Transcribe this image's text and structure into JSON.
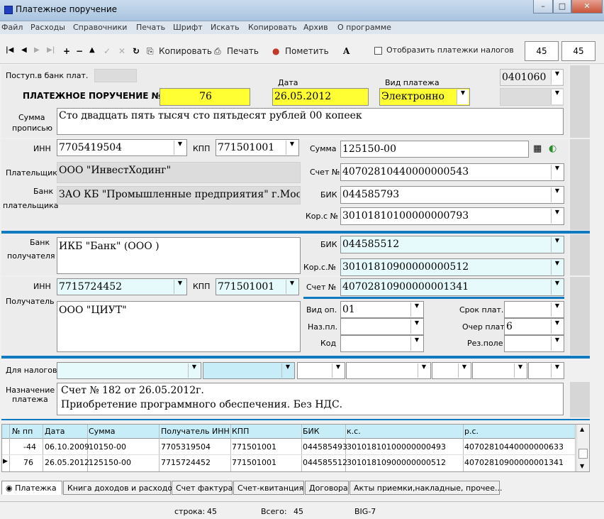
{
  "window": {
    "title": "Платежное поручение",
    "min": "–",
    "max": "□",
    "close": "✕"
  },
  "menu": [
    "Файл",
    "Расходы",
    "Справочники",
    "Печать",
    "Шрифт",
    "Искать",
    "Копировать",
    "Архив",
    "О программе"
  ],
  "toolbar": {
    "copy": "Копировать",
    "print": "Печать",
    "mark": "Пометить",
    "show_taxes": "Отобразить платежки налогов",
    "count1": "45",
    "count2": "45"
  },
  "form": {
    "arrival_label": "Поступ.в банк плат.",
    "doc_code": "0401060",
    "title_label": "ПЛАТЕЖНОЕ ПОРУЧЕНИЕ  №",
    "number": "76",
    "date_label": "Дата",
    "date": "26.05.2012",
    "kind_label": "Вид платежа",
    "kind": "Электронно",
    "amount_words_label1": "Сумма",
    "amount_words_label2": "прописью",
    "amount_words": "Сто двадцать пять тысяч сто пятьдесят рублей  00  копеек",
    "payer": {
      "inn_label": "ИНН",
      "inn": "7705419504",
      "kpp_label": "КПП",
      "kpp": "771501001",
      "name_label": "Плательщик",
      "name": "ООО \"ИнвестХодинг\"",
      "bank_label1": "Банк",
      "bank_label2": "плательщика",
      "bank": "ЗАО КБ \"Промышленные предприятия\" г.Москва",
      "sum_label": "Сумма",
      "sum": "125150-00",
      "acc_label": "Счет №",
      "acc": "40702810440000000543",
      "bik_label": "БИК",
      "bik": "044585793",
      "kors_label": "Кор.с  №",
      "kors": "30101810100000000793"
    },
    "recipient": {
      "bank_label1": "Банк",
      "bank_label2": "получателя",
      "bank": "ИКБ  \"Банк\" (ООО )",
      "bik_label": "БИК",
      "bik": "044585512",
      "kors_label": "Кор.с.№",
      "kors": "30101810900000000512",
      "inn_label": "ИНН",
      "inn": "7715724452",
      "kpp_label": "КПП",
      "kpp": "771501001",
      "acc_label": "Счет №",
      "acc": "40702810900000001341",
      "name_label": "Получатель",
      "name": "ООО \"ЦИУТ\""
    },
    "extra": {
      "vid_op_label": "Вид оп.",
      "vid_op": "01",
      "naz_pl_label": "Наз.пл.",
      "kod_label": "Код",
      "srok_label": "Срок плат.",
      "ocher_label": "Очер плат",
      "ocher": "6",
      "rez_label": "Рез.поле"
    },
    "tax_label": "Для налогов",
    "purpose_label1": "Назначение",
    "purpose_label2": "платежа",
    "purpose_line1": "Счет № 182 от 26.05.2012г.",
    "purpose_line2": "Приобретение программного обеспечения. Без НДС."
  },
  "grid": {
    "columns": [
      "№ пп",
      "Дата",
      "Сумма",
      "Получатель ИНН",
      "КПП",
      "БИК",
      "к.с.",
      "р.с."
    ],
    "rows": [
      [
        "-44",
        "06.10.2009",
        "10150-00",
        "7705319504",
        "771501001",
        "044585493",
        "30101810100000000493",
        "40702810440000000633"
      ],
      [
        "76",
        "26.05.2012",
        "125150-00",
        "7715724452",
        "771501001",
        "044585512",
        "30101810900000000512",
        "40702810900000001341"
      ]
    ]
  },
  "tabs": [
    "Платежка",
    "Книга доходов и расходов",
    "Счет фактура",
    "Счет-квитанция",
    "Договора",
    "Акты приемки,накладные, прочее..."
  ],
  "status": {
    "row_label": "строка:",
    "row": "45",
    "total_label": "Всего:",
    "total": "45",
    "db": "BIG-7"
  }
}
